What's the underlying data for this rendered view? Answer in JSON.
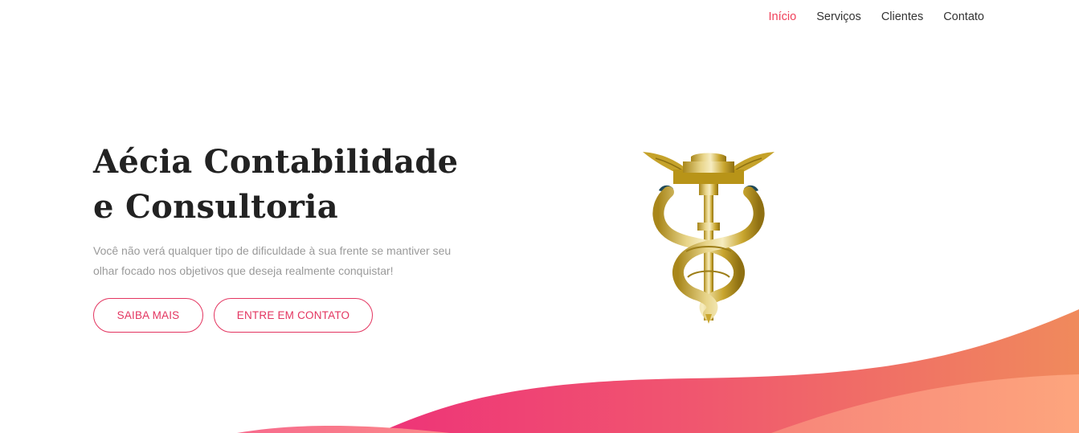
{
  "nav": {
    "items": [
      {
        "label": "Início",
        "active": true
      },
      {
        "label": "Serviços",
        "active": false
      },
      {
        "label": "Clientes",
        "active": false
      },
      {
        "label": "Contato",
        "active": false
      }
    ]
  },
  "hero": {
    "title_line1": "Aécia Contabilidade",
    "title_line2": "e Consultoria",
    "subtitle": "Você não verá qualquer tipo de dificuldade à sua frente se mantiver seu olhar focado nos objetivos que deseja realmente conquistar!",
    "primary_button": "SAIBA MAIS",
    "secondary_button": "ENTRE EM CONTATO"
  },
  "emblem": {
    "icon": "caduceus-icon"
  },
  "colors": {
    "accent": "#f0405a",
    "wave_pink": "#ee3a7a",
    "wave_orange": "#f08a5d",
    "wave_peach": "#fba17c",
    "gold": "#c9a227"
  }
}
